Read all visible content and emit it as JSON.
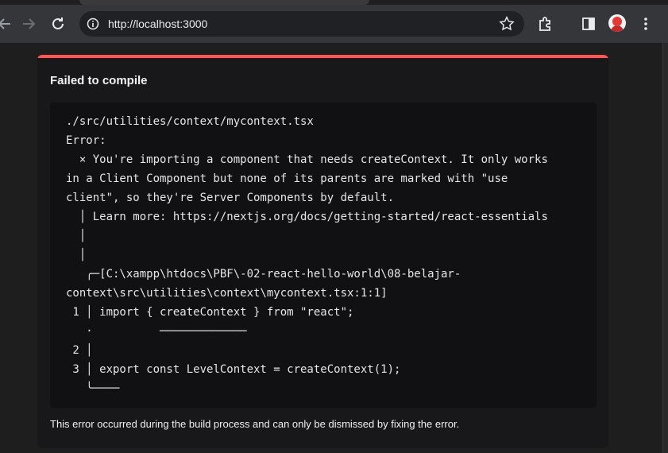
{
  "browser": {
    "url": "http://localhost:3000",
    "icons": [
      "back-icon",
      "forward-icon",
      "reload-icon",
      "site-info-icon",
      "bookmark-star-icon",
      "extensions-icon",
      "side-panel-icon",
      "profile-avatar",
      "more-menu-icon"
    ]
  },
  "dialog": {
    "title": "Failed to compile",
    "accent_color": "#ff5555",
    "code_lines": [
      "./src/utilities/context/mycontext.tsx",
      "Error:",
      "  × You're importing a component that needs createContext. It only works",
      "in a Client Component but none of its parents are marked with \"use",
      "client\", so they're Server Components by default.",
      "  │ Learn more: https://nextjs.org/docs/getting-started/react-essentials",
      "  │",
      "  │",
      "   ╭─[C:\\xampp\\htdocs\\PBF\\-02-react-hello-world\\08-belajar-",
      "context\\src\\utilities\\context\\mycontext.tsx:1:1]",
      " 1 │ import { createContext } from \"react\";",
      "   ·          ─────────────",
      " 2 │",
      " 3 │ export const LevelContext = createContext(1);",
      "   ╰────"
    ],
    "footer": "This error occurred during the build process and can only be dismissed by fixing the error."
  }
}
